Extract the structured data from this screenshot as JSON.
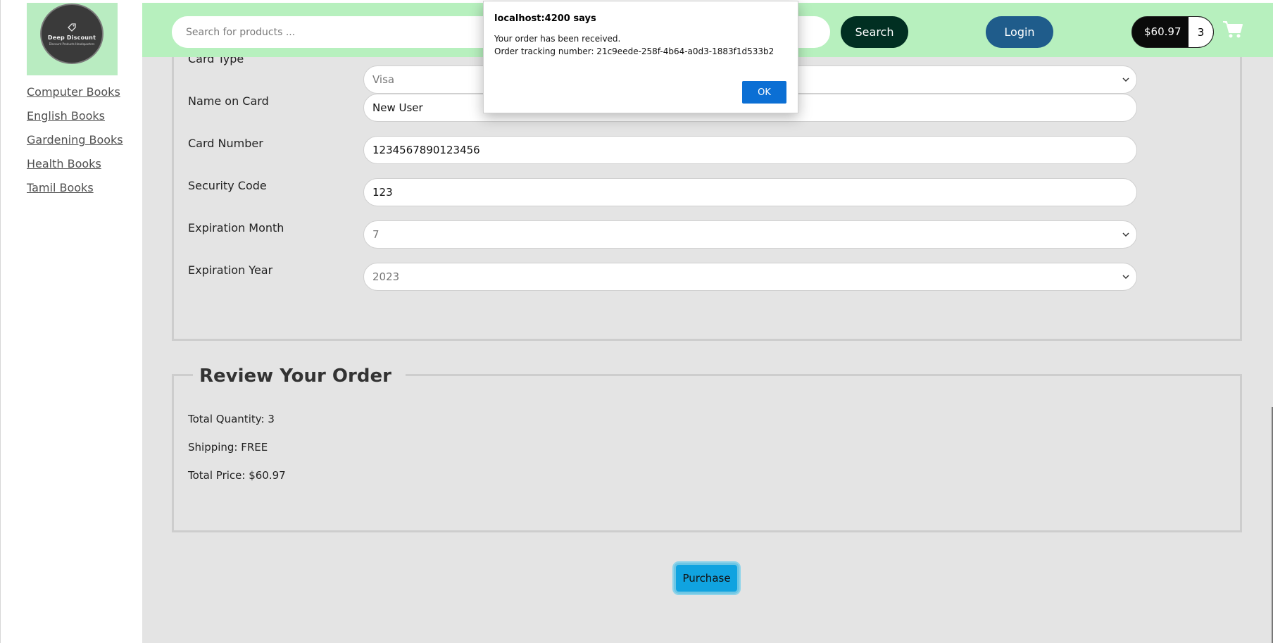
{
  "brand": {
    "logo_title": "Deep Discount",
    "logo_subtitle": "Discount Products Headquarters"
  },
  "sidebar": {
    "items": [
      {
        "label": "Computer Books"
      },
      {
        "label": "English Books"
      },
      {
        "label": "Gardening Books"
      },
      {
        "label": "Health Books"
      },
      {
        "label": "Tamil Books"
      }
    ]
  },
  "header": {
    "search_placeholder": "Search for products ...",
    "search_label": "Search",
    "login_label": "Login",
    "cart_total": "$60.97",
    "cart_count": "3",
    "cart_icon": "shopping-cart-icon"
  },
  "payment": {
    "card_type": {
      "label": "Card Type",
      "value": "Visa"
    },
    "name_on_card": {
      "label": "Name on Card",
      "value": "New User"
    },
    "card_number": {
      "label": "Card Number",
      "value": "1234567890123456"
    },
    "security_code": {
      "label": "Security Code",
      "value": "123"
    },
    "exp_month": {
      "label": "Expiration Month",
      "value": "7"
    },
    "exp_year": {
      "label": "Expiration Year",
      "value": "2023"
    }
  },
  "review": {
    "title": "Review Your Order",
    "total_quantity": "Total Quantity: 3",
    "shipping": "Shipping: FREE",
    "total_price": "Total Price: $60.97"
  },
  "purchase_label": "Purchase",
  "dialog": {
    "title": "localhost:4200 says",
    "message1": "Your order has been received.",
    "message2": "Order tracking number: 21c9eede-258f-4b64-a0d3-1883f1d533b2",
    "ok_label": "OK"
  },
  "colors": {
    "header_bg": "#b7f0be",
    "search_btn": "#012f22",
    "login_btn": "#1f5c8b",
    "purchase_btn": "#10a3e0",
    "dialog_ok": "#0b6fd4"
  }
}
